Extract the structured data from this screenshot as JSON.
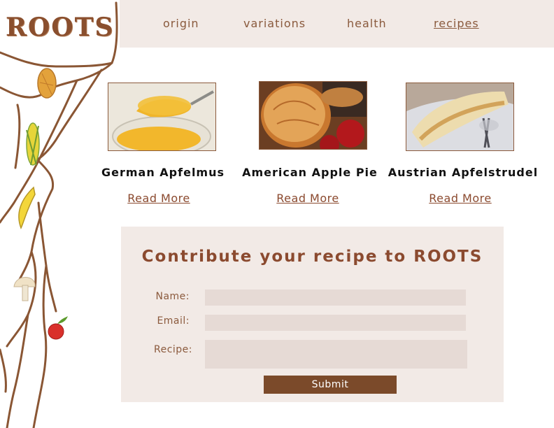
{
  "logo": {
    "text": "ROOTS"
  },
  "nav": {
    "items": [
      {
        "label": "origin"
      },
      {
        "label": "variations"
      },
      {
        "label": "health"
      },
      {
        "label": "recipes"
      }
    ]
  },
  "recipes": [
    {
      "title": "German Apfelmus",
      "link": "Read More",
      "image": "applesauce-photo"
    },
    {
      "title": "American Apple Pie",
      "link": "Read More",
      "image": "apple-pie-photo"
    },
    {
      "title": "Austrian Apfelstrudel",
      "link": "Read More",
      "image": "apple-strudel-photo"
    }
  ],
  "contribute": {
    "heading": "Contribute your recipe to ROOTS",
    "name_label": "Name:",
    "email_label": "Email:",
    "recipe_label": "Recipe:",
    "name_value": "",
    "email_value": "",
    "recipe_value": "",
    "submit_label": "Submit"
  },
  "colors": {
    "brown": "#8b4a2f",
    "panel": "#f2eae6",
    "field": "#e6dad5",
    "button": "#7b4a2a"
  },
  "decorations": [
    "almond-icon",
    "corn-icon",
    "banana-icon",
    "mushroom-icon",
    "apple-icon"
  ]
}
